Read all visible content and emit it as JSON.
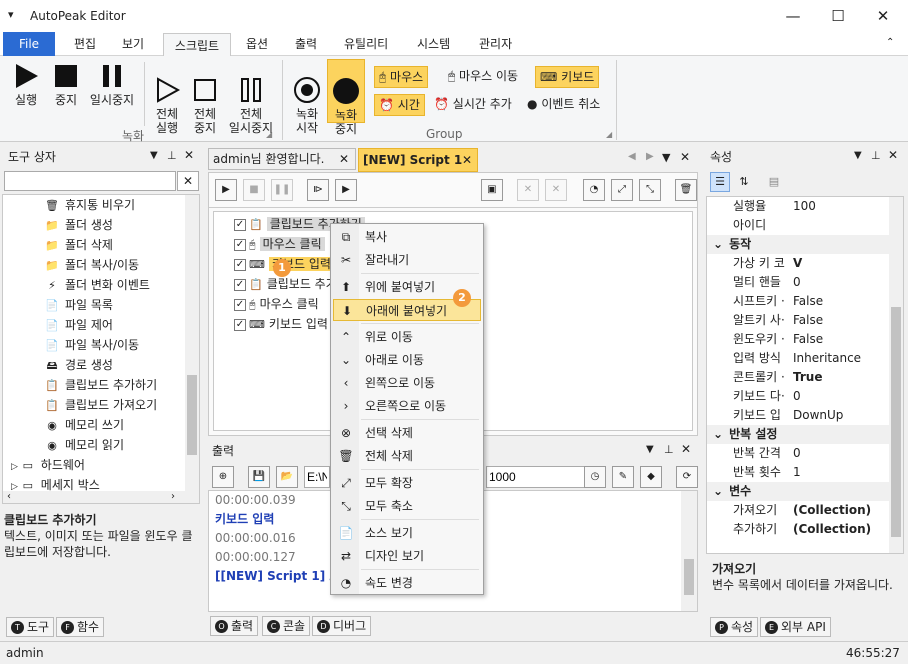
{
  "window": {
    "title": "AutoPeak Editor",
    "minimize": "—",
    "maximize": "☐",
    "close": "✕"
  },
  "menu": {
    "file": "File",
    "items": [
      "편집",
      "보기",
      "스크립트",
      "옵션",
      "출력",
      "유틸리티",
      "시스템",
      "관리자"
    ],
    "active_index": 2
  },
  "ribbon": {
    "record_group": {
      "label": "녹화",
      "run": "실행",
      "stop": "중지",
      "pause": "일시중지",
      "run_all": "전체\n실행",
      "stop_all": "전체\n중지",
      "pause_all": "전체\n일시중지"
    },
    "group": {
      "label": "Group",
      "record_start": "녹화\n시작",
      "record_stop": "녹화\n중지",
      "mouse": "마우스",
      "mouse_move": "마우스 이동",
      "keyboard": "키보드",
      "time": "시간",
      "realtime_add": "실시간 추가",
      "event_cancel": "이벤트 취소"
    }
  },
  "toolbox": {
    "title": "도구 상자",
    "search_placeholder": "",
    "items": [
      "휴지통 비우기",
      "폴더 생성",
      "폴더 삭제",
      "폴더 복사/이동",
      "폴더 변화 이벤트",
      "파일 목록",
      "파일 제어",
      "파일 복사/이동",
      "경로 생성",
      "클립보드 추가하기",
      "클립보드 가져오기",
      "메모리 쓰기",
      "메모리 읽기"
    ],
    "groups": [
      "하드웨어",
      "메세지 박스"
    ],
    "desc_title": "클립보드 추가하기",
    "desc_text": "텍스트, 이미지 또는 파일을 윈도우 클립보드에 저장합니다.",
    "tabs": [
      "도구",
      "함수"
    ],
    "tab_icons": [
      "T",
      "F"
    ]
  },
  "editor": {
    "tabs": [
      "admin님 환영합니다.",
      "[NEW] Script 1"
    ],
    "script_rows": [
      "클립보드 추가하기",
      "마우스 클릭",
      "키보드 입력",
      "클립보드 추가",
      "마우스 클릭",
      "키보드 입력"
    ]
  },
  "output": {
    "title": "출력",
    "path_value": "E:\\N",
    "count_value": "1000",
    "lines": [
      {
        "text": "00:00:00.039",
        "kind": "time"
      },
      {
        "text": "키보드 입력",
        "kind": "blue"
      },
      {
        "text": "00:00:00.016",
        "kind": "time"
      },
      {
        "text": "00:00:00.127",
        "kind": "time"
      },
      {
        "text": "[[NEW] Script 1] 스크",
        "kind": "blue"
      }
    ],
    "tabs": [
      "출력",
      "콘솔",
      "디버그"
    ],
    "tab_icons": [
      "O",
      "C",
      "D"
    ]
  },
  "context_menu": {
    "items": [
      "복사",
      "잘라내기",
      "위에 붙여넣기",
      "아래에 붙여넣기",
      "위로 이동",
      "아래로 이동",
      "왼쪽으로 이동",
      "오른쪽으로 이동",
      "선택 삭제",
      "전체 삭제",
      "모두 확장",
      "모두 축소",
      "소스 보기",
      "디자인 보기",
      "속도 변경"
    ],
    "highlighted_index": 3
  },
  "badges": [
    "1",
    "2"
  ],
  "properties": {
    "title": "속성",
    "rows": [
      {
        "type": "prop",
        "name": "실행율",
        "value": "100"
      },
      {
        "type": "prop",
        "name": "아이디",
        "value": ""
      },
      {
        "type": "cat",
        "name": "동작"
      },
      {
        "type": "prop",
        "name": "가상 키 코",
        "value": "V",
        "bold": true
      },
      {
        "type": "prop",
        "name": "멀티 핸들",
        "value": "0"
      },
      {
        "type": "prop",
        "name": "시프트키 ·",
        "value": "False"
      },
      {
        "type": "prop",
        "name": "알트키 사·",
        "value": "False"
      },
      {
        "type": "prop",
        "name": "윈도우키 ·",
        "value": "False"
      },
      {
        "type": "prop",
        "name": "입력 방식",
        "value": "Inheritance"
      },
      {
        "type": "prop",
        "name": "콘트롤키 ·",
        "value": "True",
        "bold": true
      },
      {
        "type": "prop",
        "name": "키보드 다·",
        "value": "0"
      },
      {
        "type": "prop",
        "name": "키보드 입",
        "value": "DownUp"
      },
      {
        "type": "cat",
        "name": "반복 설정"
      },
      {
        "type": "prop",
        "name": "반복 간격",
        "value": "0"
      },
      {
        "type": "prop",
        "name": "반복 횟수",
        "value": "1"
      },
      {
        "type": "cat",
        "name": "변수"
      },
      {
        "type": "prop",
        "name": "가져오기",
        "value": "(Collection)",
        "bold": true
      },
      {
        "type": "prop",
        "name": "추가하기",
        "value": "(Collection)",
        "bold": true
      }
    ],
    "desc_title": "가져오기",
    "desc_text": "변수 목록에서 데이터를 가져옵니다.",
    "tabs": [
      "속성",
      "외부 API"
    ],
    "tab_icons": [
      "P",
      "E"
    ]
  },
  "status": {
    "user": "admin",
    "time": "46:55:27"
  }
}
